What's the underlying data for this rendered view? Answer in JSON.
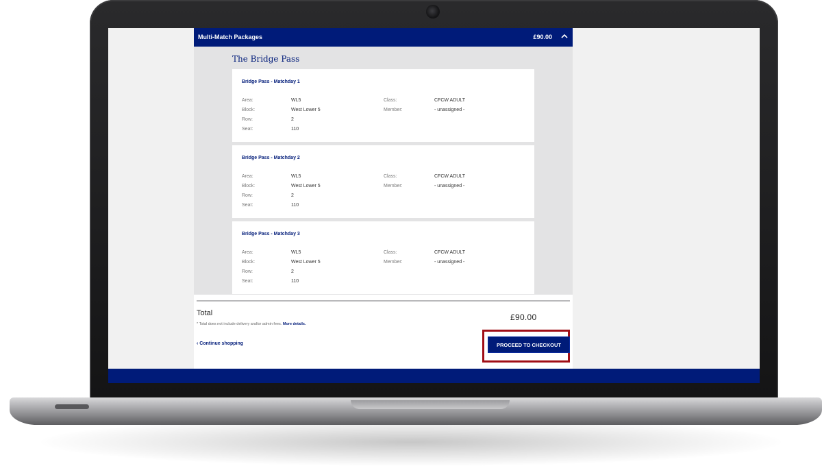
{
  "package": {
    "title": "Multi-Match Packages",
    "price": "£90.00",
    "pass_name": "The Bridge Pass",
    "matches": [
      {
        "title": "Bridge Pass - Matchday 1",
        "area_label": "Area:",
        "area": "WL5",
        "block_label": "Block:",
        "block": "West Lower 5",
        "row_label": "Row:",
        "row": "2",
        "seat_label": "Seat:",
        "seat": "110",
        "class_label": "Class:",
        "class": "CFCW ADULT",
        "member_label": "Member:",
        "member": "- unassigned -"
      },
      {
        "title": "Bridge Pass - Matchday 2",
        "area_label": "Area:",
        "area": "WL5",
        "block_label": "Block:",
        "block": "West Lower 5",
        "row_label": "Row:",
        "row": "2",
        "seat_label": "Seat:",
        "seat": "110",
        "class_label": "Class:",
        "class": "CFCW ADULT",
        "member_label": "Member:",
        "member": "- unassigned -"
      },
      {
        "title": "Bridge Pass - Matchday 3",
        "area_label": "Area:",
        "area": "WL5",
        "block_label": "Block:",
        "block": "West Lower 5",
        "row_label": "Row:",
        "row": "2",
        "seat_label": "Seat:",
        "seat": "110",
        "class_label": "Class:",
        "class": "CFCW ADULT",
        "member_label": "Member:",
        "member": "- unassigned -"
      }
    ]
  },
  "summary": {
    "total_label": "Total",
    "total_amount": "£90.00",
    "fees_note": "* Total does not include delivery and/or admin fees.",
    "fees_link": "More details.",
    "continue_label": "Continue shopping",
    "checkout_label": "PROCEED TO CHECKOUT"
  },
  "colors": {
    "brand_blue": "#001b79",
    "highlight_red": "#a00e16"
  }
}
